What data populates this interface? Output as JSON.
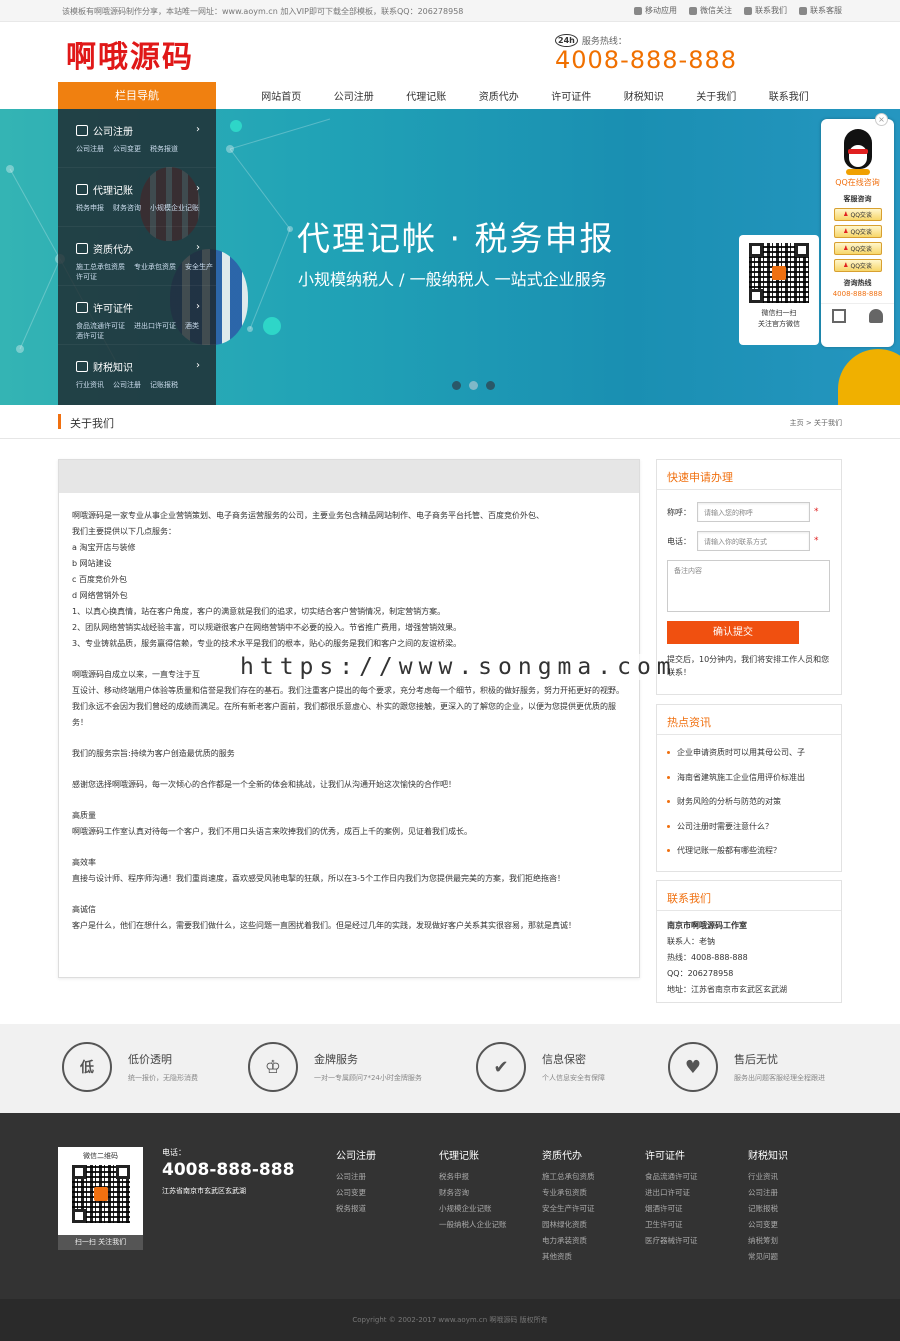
{
  "topbar": {
    "notice": "该模板有啊哦源码制作分享，本站唯一网址：www.aoym.cn 加入VIP即可下载全部模板，联系QQ：206278958",
    "links": [
      "移动应用",
      "微信关注",
      "联系我们",
      "联系客服"
    ]
  },
  "header": {
    "logo": "啊哦源码",
    "hotline_label": "服务热线：",
    "hotline_badge": "24h",
    "hotline": "4008-888-888"
  },
  "nav": {
    "category": "栏目导航",
    "items": [
      "网站首页",
      "公司注册",
      "代理记账",
      "资质代办",
      "许可证件",
      "财税知识",
      "关于我们",
      "联系我们"
    ]
  },
  "sidemenu": [
    {
      "title": "公司注册",
      "subs": [
        "公司注册",
        "公司变更",
        "税务报道"
      ]
    },
    {
      "title": "代理记账",
      "subs": [
        "税务申报",
        "财务咨询",
        "小规模企业记账"
      ]
    },
    {
      "title": "资质代办",
      "subs": [
        "施工总承包资质",
        "专业承包资质",
        "安全生产许可证"
      ]
    },
    {
      "title": "许可证件",
      "subs": [
        "食品流通许可证",
        "进出口许可证",
        "酒类",
        "酒许可证"
      ]
    },
    {
      "title": "财税知识",
      "subs": [
        "行业资讯",
        "公司注册",
        "记账报税"
      ]
    }
  ],
  "banner": {
    "title": "代理记帐 · 税务申报",
    "subtitle": "小规模纳税人 / 一般纳税人  一站式企业服务",
    "qr_caption1": "微信扫一扫",
    "qr_caption2": "关注官方微信"
  },
  "qq": {
    "title": "QQ在线咨询",
    "group": "客服咨询",
    "btn": "QQ交谈",
    "hotline_label": "咨询热线",
    "hotline": "4008-888-888"
  },
  "section": {
    "title": "关于我们",
    "crumb": "主页 > 关于我们"
  },
  "about": [
    "啊哦源码是一家专业从事企业营销策划、电子商务运营服务的公司，主要业务包含精品网站制作、电子商务平台托管、百度竞价外包、",
    "我们主要提供以下几点服务：",
    "a  淘宝开店与装修",
    "b  网站建设",
    "c  百度竞价外包",
    "d  网络营销外包",
    "1、以真心换真情，站在客户角度，客户的满意就是我们的追求，切实结合客户营销情况，制定营销方案。",
    "2、团队网络营销实战经验丰富，可以规避很客户在网络营销中不必要的投入。节省推广费用，增强营销效果。",
    "3、专业铸就品质，服务赢得信赖，专业的技术水平是我们的根本，贴心的服务是我们和客户之间的友谊桥梁。"
  ],
  "about2": "啊哦源码自成立以来，一直专注于互",
  "about2b": "互设计、移动终端用户体验等质量和信誉是我们存在的基石。我们注重客户提出的每个要求，充分考虑每一个细节，积极的做好服务，努力开拓更好的视野。我们永远不会因为我们曾经的成绩而满足。在所有新老客户面前，我们都很乐意虚心、朴实的跟您接触，更深入的了解您的企业，以便为您提供更优质的服务！",
  "about3": "我们的服务宗旨:持续为客户创造最优质的服务",
  "about4": "感谢您选择啊哦源码，每一次倾心的合作都是一个全新的体会和挑战，让我们从沟通开始这次愉快的合作吧！",
  "q1": {
    "h": "高质量",
    "t": "啊哦源码工作室认真对待每一个客户，我们不用口头语言来吹捧我们的优秀，成百上千的案例，见证着我们成长。"
  },
  "q2": {
    "h": "高效率",
    "t": "直接与设计师、程序师沟通！我们重尚速度，喜欢感受风驰电掣的狂飙，所以在3-5个工作日内我们为您提供最完美的方案，我们拒绝拖沓！"
  },
  "q3": {
    "h": "高诚信",
    "t": "客户是什么，他们在想什么，需要我们做什么，这些问题一直困扰着我们。但是经过几年的实践，发现做好客户关系其实很容易，那就是真诚！"
  },
  "form": {
    "title": "快速申请办理",
    "name_label": "称呼：",
    "name_ph": "请输入您的称呼",
    "phone_label": "电话：",
    "phone_ph": "请输入你的联系方式",
    "note_ph": "备注内容",
    "submit": "确认提交",
    "tip": "提交后，10分钟内，我们将安排工作人员和您联系！"
  },
  "hot": {
    "title": "热点资讯",
    "items": [
      "企业申请资质时可以用其母公司、子",
      "海南省建筑施工企业信用评价标准出",
      "财务风险的分析与防范的对策",
      "公司注册时需要注意什么？",
      "代理记账一般都有哪些流程？"
    ]
  },
  "contact": {
    "title": "联系我们",
    "company": "南京市啊哦源码工作室",
    "person": "联系人：老钠",
    "tel": "热线：4008-888-888",
    "qq": "QQ：206278958",
    "addr": "地址：江苏省南京市玄武区玄武湖"
  },
  "features": [
    {
      "icon": "低",
      "title": "低价透明",
      "desc": "统一报价，无隐形消费"
    },
    {
      "icon": "♔",
      "title": "金牌服务",
      "desc": "一对一专属顾问7*24小时金牌服务"
    },
    {
      "icon": "✔",
      "title": "信息保密",
      "desc": "个人信息安全有保障"
    },
    {
      "icon": "♥",
      "title": "售后无忧",
      "desc": "服务出问题客服经理全程跟进"
    }
  ],
  "footer": {
    "qr_title": "微信二维码",
    "qr_caption": "扫一扫 关注我们",
    "tel_label": "电话：",
    "tel": "4008-888-888",
    "addr": "江苏省南京市玄武区玄武湖",
    "cols": [
      {
        "h": "公司注册",
        "items": [
          "公司注册",
          "公司变更",
          "税务报道"
        ]
      },
      {
        "h": "代理记账",
        "items": [
          "税务申报",
          "财务咨询",
          "小规模企业记账",
          "一般纳税人企业记账"
        ]
      },
      {
        "h": "资质代办",
        "items": [
          "施工总承包资质",
          "专业承包资质",
          "安全生产许可证",
          "园林绿化资质",
          "电力承装资质",
          "其他资质"
        ]
      },
      {
        "h": "许可证件",
        "items": [
          "食品流通许可证",
          "进出口许可证",
          "烟酒许可证",
          "卫生许可证",
          "医疗器械许可证"
        ]
      },
      {
        "h": "财税知识",
        "items": [
          "行业资讯",
          "公司注册",
          "记账报税",
          "公司变更",
          "纳税筹划",
          "常见问题"
        ]
      }
    ],
    "copyright": "Copyright © 2002-2017 www.aoym.cn 啊哦源码 版权所有"
  },
  "watermark": "https://www.songma.com",
  "colors": {
    "accent": "#f07010",
    "logo": "#e01818",
    "banner": "#21a3b6",
    "footer": "#333333"
  }
}
